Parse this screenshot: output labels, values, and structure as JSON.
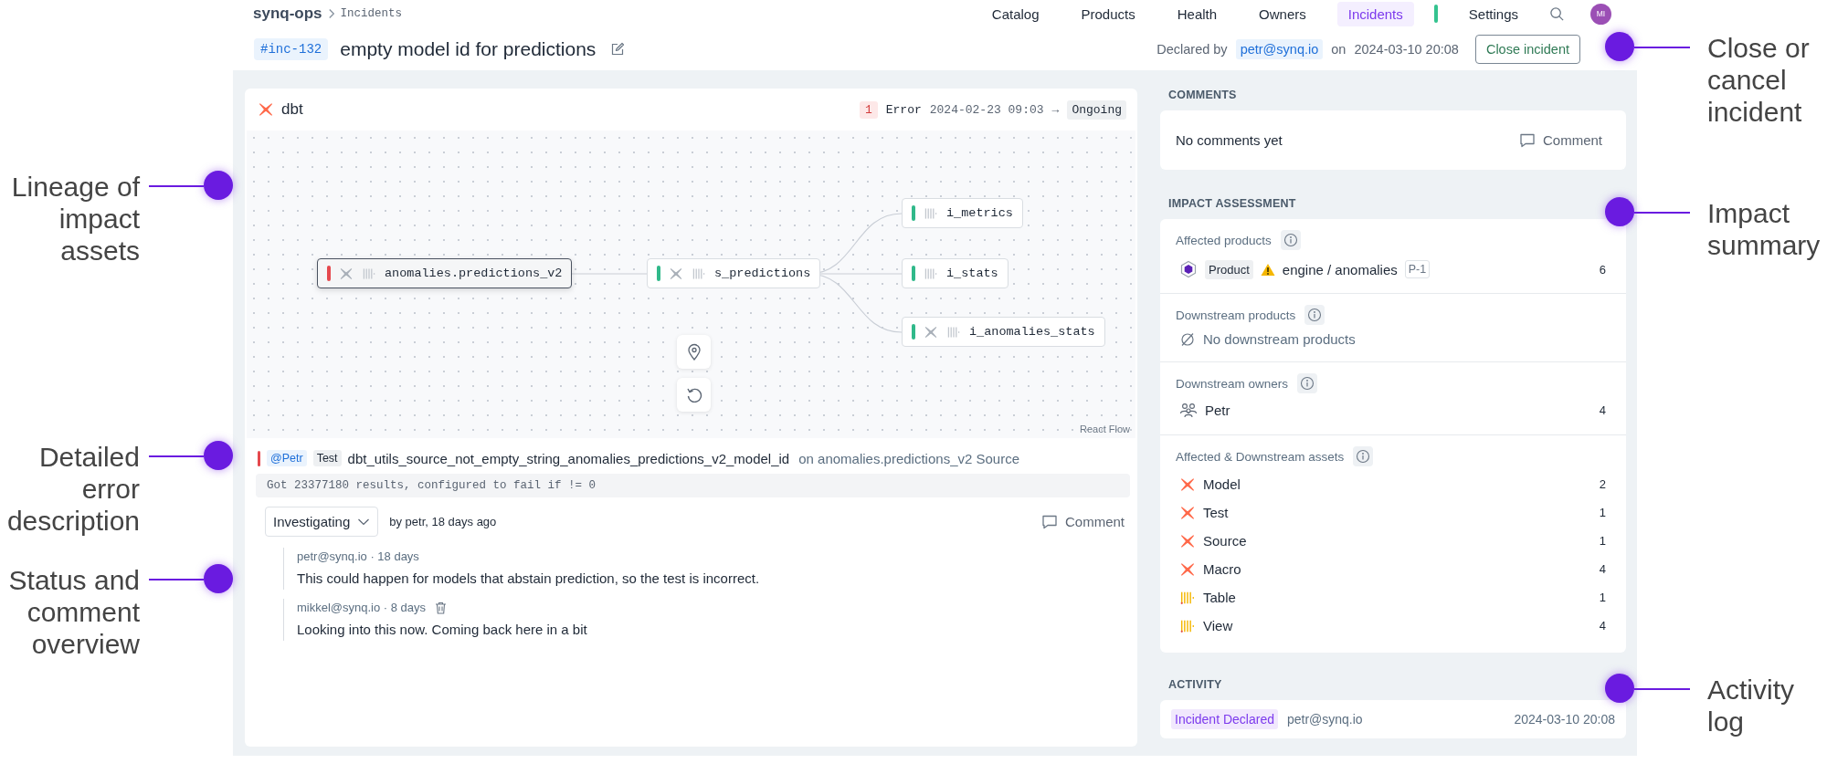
{
  "callouts_left": [
    {
      "text": "Lineage of\nimpact\nassets"
    },
    {
      "text": "Detailed\nerror\ndescription"
    },
    {
      "text": "Status and\ncomment\noverview"
    }
  ],
  "callouts_right": [
    {
      "text": "Close or\ncancel\nincident"
    },
    {
      "text": "Impact\nsummary"
    },
    {
      "text": "Activity\nlog"
    }
  ],
  "nav": {
    "workspace": "synq-ops",
    "breadcrumb": "Incidents",
    "avatar": "MI",
    "items": [
      {
        "label": "Catalog",
        "selected": false
      },
      {
        "label": "Products",
        "selected": false
      },
      {
        "label": "Health",
        "selected": false
      },
      {
        "label": "Owners",
        "selected": false
      },
      {
        "label": "Incidents",
        "selected": true
      },
      {
        "label": "Settings",
        "selected": false
      }
    ]
  },
  "incident": {
    "id": "#inc-132",
    "title": "empty model id for predictions",
    "declared_label": "Declared by",
    "declared_by": "petr@synq.io",
    "on_label": "on",
    "declared_at": "2024-03-10 20:08",
    "close_button": "Close incident"
  },
  "lineage": {
    "source": "dbt",
    "error_count": "1",
    "error_label": "Error",
    "started": "2024-02-23 09:03",
    "arrow": "→",
    "status": "Ongoing",
    "attribution": "React Flow",
    "nodes": [
      {
        "label": "anomalies.predictions_v2",
        "color": "#e5484d",
        "kind": "dbt_model",
        "selected": true
      },
      {
        "label": "s_predictions",
        "color": "#30b98a",
        "kind": "dbt_model",
        "selected": false
      },
      {
        "label": "i_metrics",
        "color": "#30b98a",
        "kind": "table",
        "selected": false
      },
      {
        "label": "i_stats",
        "color": "#30b98a",
        "kind": "table",
        "selected": false
      },
      {
        "label": "i_anomalies_stats",
        "color": "#30b98a",
        "kind": "dbt_model",
        "selected": false
      }
    ]
  },
  "error": {
    "mention": "@Petr",
    "type": "Test",
    "name": "dbt_utils_source_not_empty_string_anomalies_predictions_v2_model_id",
    "location": "on anomalies.predictions_v2 Source",
    "message": "Got 23377180 results, configured to fail if != 0"
  },
  "status": {
    "value": "Investigating",
    "by": "by petr, 18 days ago",
    "comment_button": "Comment"
  },
  "comments": [
    {
      "meta": "petr@synq.io · 18 days",
      "text": "This could happen for models that abstain prediction, so the test is incorrect.",
      "deletable": false
    },
    {
      "meta": "mikkel@synq.io · 8 days",
      "text": "Looking into this now. Coming back here in a bit",
      "deletable": true
    }
  ],
  "comments_panel": {
    "heading": "COMMENTS",
    "empty": "No comments yet",
    "button": "Comment"
  },
  "impact": {
    "heading": "IMPACT ASSESSMENT",
    "affected_products": {
      "label": "Affected products",
      "items": [
        {
          "tag": "Product",
          "warning": true,
          "name": "engine / anomalies",
          "priority": "P-1",
          "count": "6"
        }
      ]
    },
    "downstream_products": {
      "label": "Downstream products",
      "empty": "No downstream products"
    },
    "downstream_owners": {
      "label": "Downstream owners",
      "items": [
        {
          "name": "Petr",
          "count": "4"
        }
      ]
    },
    "assets": {
      "label": "Affected & Downstream assets",
      "items": [
        {
          "kind": "dbt",
          "name": "Model",
          "count": "2"
        },
        {
          "kind": "dbt",
          "name": "Test",
          "count": "1"
        },
        {
          "kind": "dbt",
          "name": "Source",
          "count": "1"
        },
        {
          "kind": "dbt",
          "name": "Macro",
          "count": "4"
        },
        {
          "kind": "table",
          "name": "Table",
          "count": "1"
        },
        {
          "kind": "table",
          "name": "View",
          "count": "4"
        }
      ]
    }
  },
  "activity": {
    "heading": "ACTIVITY",
    "entries": [
      {
        "event": "Incident Declared",
        "user": "petr@synq.io",
        "time": "2024-03-10 20:08"
      }
    ]
  }
}
